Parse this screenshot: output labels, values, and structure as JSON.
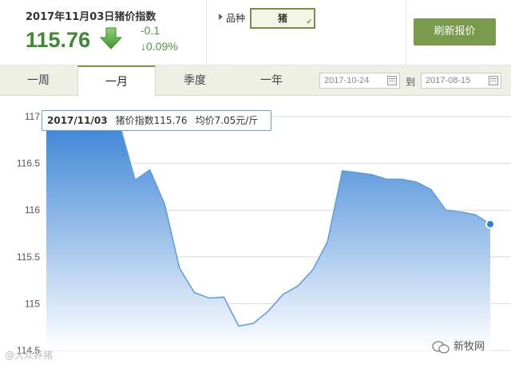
{
  "header": {
    "title": "2017年11月03日猪价指数",
    "index_value": "115.76",
    "change_abs": "-0.1",
    "change_pct": "↓0.09%",
    "arrow_icon": "down-arrow-icon"
  },
  "variety": {
    "label": "品种",
    "selected": "猪"
  },
  "refresh_button": "刷新报价",
  "tabs": [
    {
      "label": "一周"
    },
    {
      "label": "一月",
      "active": true
    },
    {
      "label": "季度"
    },
    {
      "label": "一年"
    }
  ],
  "date_range": {
    "from": "2017-10-24",
    "separator": "到",
    "to": "2017-08-15"
  },
  "tooltip": {
    "date": "2017/11/03",
    "index_text": "猪价指数115.76",
    "price_text": "均价7.05元/斤"
  },
  "watermarks": {
    "left": "@大众养猪",
    "right": "新牧网"
  },
  "colors": {
    "accent_green": "#7a9a4b",
    "value_green": "#3b8a2e",
    "line_blue": "#4a90d9",
    "area_top": "#3f86d6",
    "area_bottom": "#ffffff"
  },
  "chart_data": {
    "type": "area",
    "ylim": [
      114.5,
      117
    ],
    "yticks": [
      "117",
      "116.5",
      "116",
      "115.5",
      "115",
      "114.5"
    ],
    "grid": true,
    "values": [
      116.9,
      116.9,
      116.9,
      116.9,
      116.9,
      116.89,
      116.32,
      116.43,
      116.06,
      115.38,
      115.12,
      115.06,
      115.07,
      114.76,
      114.79,
      114.92,
      115.1,
      115.19,
      115.36,
      115.66,
      116.42,
      116.4,
      116.38,
      116.33,
      116.33,
      116.3,
      116.22,
      116.0,
      115.98,
      115.95,
      115.85
    ]
  }
}
